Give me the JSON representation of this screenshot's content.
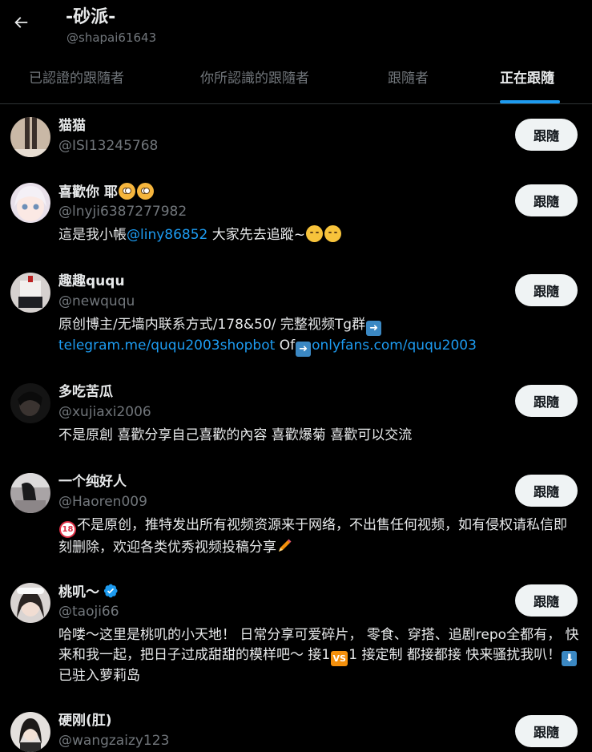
{
  "header": {
    "title": "-砂派-",
    "handle": "@shapai61643"
  },
  "tabs": [
    {
      "label": "已認證的跟隨者"
    },
    {
      "label": "你所認識的跟隨者"
    },
    {
      "label": "跟隨者"
    },
    {
      "label": "正在跟隨",
      "active": true
    }
  ],
  "users": [
    {
      "name": "猫猫",
      "handle": "@ISI13245768",
      "button": "跟隨"
    },
    {
      "name": "喜歡你 耶",
      "handle": "@lnyji6387277982",
      "button": "跟隨",
      "bio_parts": [
        "這是我小帳",
        "@liny86852",
        " 大家先去追蹤~"
      ]
    },
    {
      "name": "趣趣ququ",
      "handle": "@newququ",
      "button": "跟隨",
      "bio_parts": [
        "原创博主/无墙内联系方式/178&50/ 完整视频Tg群",
        "telegram.me/ququ2003shopbot",
        " Of",
        "onlyfans.com/ququ2003"
      ]
    },
    {
      "name": "多吃苦瓜",
      "handle": "@xujiaxi2006",
      "button": "跟隨",
      "bio": "不是原創 喜歡分享自己喜歡的內容 喜歡爆菊 喜歡可以交流"
    },
    {
      "name": "一个纯好人",
      "handle": "@Haoren009",
      "button": "跟隨",
      "bio_parts": [
        "不是原创，推特发出所有视频资源来于网络，不出售任何视频，如有侵权请私信即刻删除，欢迎各类优秀视频投稿分享"
      ]
    },
    {
      "name": "桃叽～",
      "handle": "@taoji66",
      "button": "跟隨",
      "bio_parts": [
        "哈喽～这里是桃叽的小天地！ 日常分享可爱碎片， 零食、穿搭、追剧repo全都有， 快来和我一起，把日子过成甜甜的模样吧～ 接1",
        "1 接定制 都接都接 快来骚扰我叭！",
        "已驻入萝莉岛"
      ]
    },
    {
      "name": "硬刚(肛)",
      "handle": "@wangzaizy123",
      "button": "跟隨"
    }
  ],
  "icons": {
    "back": "arrow-left-icon",
    "verified": "verified-badge-icon",
    "arrow_right": "arrow-right-emoji",
    "arrow_down": "arrow-down-emoji",
    "vs": "vs-emoji",
    "no_under18": "no-under-18-emoji"
  },
  "emoji_text": {
    "vs": "VS",
    "eighteen": "18"
  },
  "colors": {
    "background": "#000000",
    "link": "#1d9bf0",
    "secondary_text": "#71767b",
    "button_bg": "#eff3f4",
    "tab_indicator": "#1d9bf0"
  }
}
